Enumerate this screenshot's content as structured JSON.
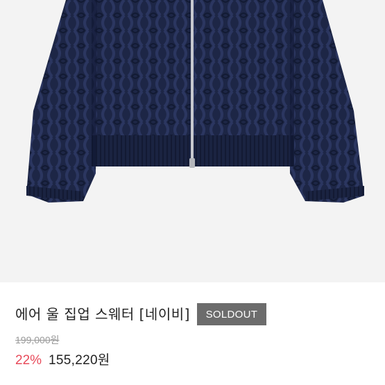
{
  "product": {
    "title": "에어 울 집업 스웨터 [네이비]",
    "badge": "SOLDOUT",
    "original_price": "199,000원",
    "discount_rate": "22%",
    "sale_price": "155,220원"
  },
  "image": {
    "subject": "navy cable-knit zip-up sweater",
    "background_color": "#f3f3f3",
    "garment_color": "#1c2545"
  },
  "colors": {
    "badge_bg": "#6c6c6c",
    "discount": "#e84b5b",
    "text": "#222222",
    "muted": "#9a9a9a"
  }
}
